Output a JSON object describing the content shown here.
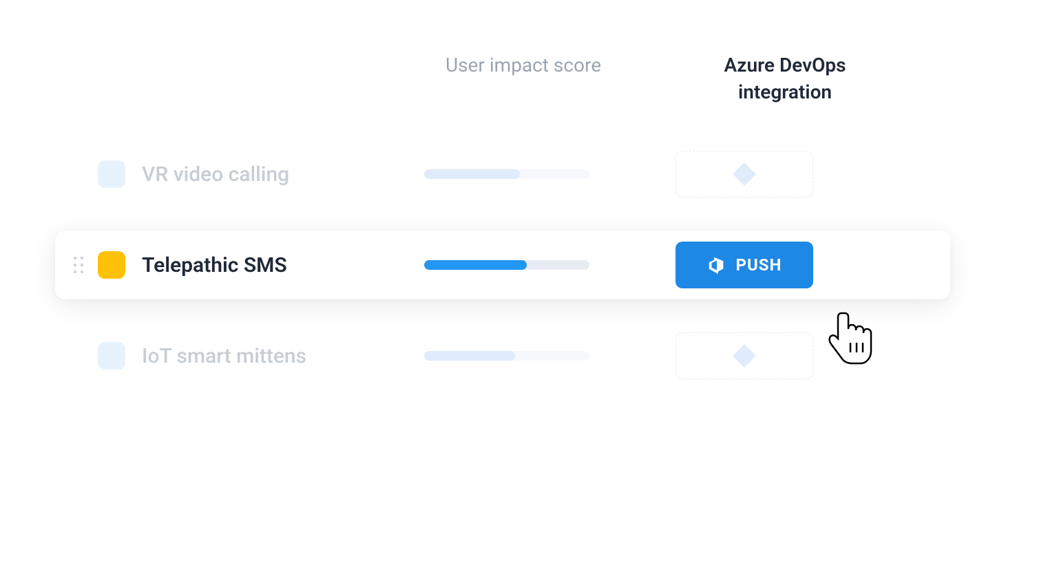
{
  "headers": {
    "impact": "User impact score",
    "integration": "Azure DevOps integration"
  },
  "rows": [
    {
      "name": "VR video calling",
      "checkbox_color": "blue",
      "impact_percent": 58,
      "active": false
    },
    {
      "name": "Telepathic SMS",
      "checkbox_color": "orange",
      "impact_percent": 62,
      "active": true,
      "button_label": "PUSH"
    },
    {
      "name": "IoT smart mittens",
      "checkbox_color": "blue",
      "impact_percent": 55,
      "active": false
    }
  ],
  "colors": {
    "accent_blue": "#1e88e5",
    "accent_orange": "#ffc107",
    "faded_blue": "#c7dcf8",
    "text_muted": "#9aa5b1",
    "text_strong": "#1f2937"
  }
}
